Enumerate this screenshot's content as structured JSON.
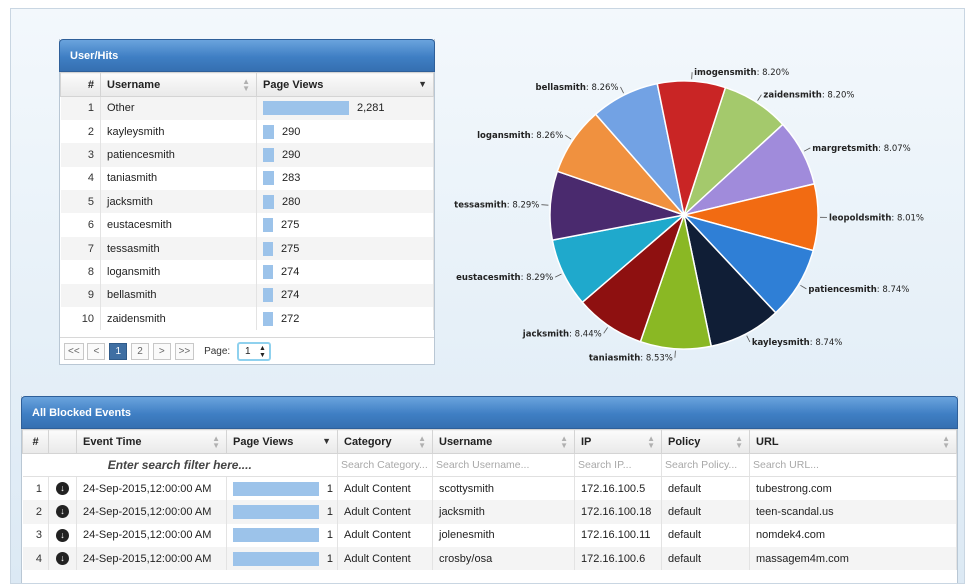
{
  "hits_panel": {
    "title": "User/Hits",
    "columns": [
      "#",
      "Username",
      "Page Views"
    ],
    "rows": [
      {
        "n": "1",
        "user": "Other",
        "views": "2,281",
        "value": 2281
      },
      {
        "n": "2",
        "user": "kayleysmith",
        "views": "290",
        "value": 290
      },
      {
        "n": "3",
        "user": "patiencesmith",
        "views": "290",
        "value": 290
      },
      {
        "n": "4",
        "user": "taniasmith",
        "views": "283",
        "value": 283
      },
      {
        "n": "5",
        "user": "jacksmith",
        "views": "280",
        "value": 280
      },
      {
        "n": "6",
        "user": "eustacesmith",
        "views": "275",
        "value": 275
      },
      {
        "n": "7",
        "user": "tessasmith",
        "views": "275",
        "value": 275
      },
      {
        "n": "8",
        "user": "logansmith",
        "views": "274",
        "value": 274
      },
      {
        "n": "9",
        "user": "bellasmith",
        "views": "274",
        "value": 274
      },
      {
        "n": "10",
        "user": "zaidensmith",
        "views": "272",
        "value": 272
      }
    ],
    "pager": {
      "first": "<<",
      "prev": "<",
      "pages": [
        "1",
        "2"
      ],
      "current": "1",
      "next": ">",
      "last": ">>",
      "page_label": "Page:",
      "page_value": "1"
    }
  },
  "chart_data": {
    "type": "pie",
    "slices": [
      {
        "name": "zaidensmith",
        "label": "8.20%",
        "value": 8.2,
        "color": "#a4c96c"
      },
      {
        "name": "margretsmith",
        "label": "8.07%",
        "value": 8.07,
        "color": "#a08bdb"
      },
      {
        "name": "leopoldsmith",
        "label": "8.01%",
        "value": 8.01,
        "color": "#f26b12"
      },
      {
        "name": "patiencesmith",
        "label": "8.74%",
        "value": 8.74,
        "color": "#2f7fd6"
      },
      {
        "name": "kayleysmith",
        "label": "8.74%",
        "value": 8.74,
        "color": "#101e36"
      },
      {
        "name": "taniasmith",
        "label": "8.53%",
        "value": 8.53,
        "color": "#8ab824"
      },
      {
        "name": "jacksmith",
        "label": "8.44%",
        "value": 8.44,
        "color": "#8e1010"
      },
      {
        "name": "eustacesmith",
        "label": "8.29%",
        "value": 8.29,
        "color": "#1fa9cc"
      },
      {
        "name": "tessasmith",
        "label": "8.29%",
        "value": 8.29,
        "color": "#4a2a6e"
      },
      {
        "name": "logansmith",
        "label": "8.26%",
        "value": 8.26,
        "color": "#f0913f"
      },
      {
        "name": "bellasmith",
        "label": "8.26%",
        "value": 8.26,
        "color": "#72a2e4"
      },
      {
        "name": "imogensmith",
        "label": "8.20%",
        "value": 8.2,
        "color": "#c92525"
      }
    ]
  },
  "events_panel": {
    "title": "All Blocked Events",
    "columns": [
      "#",
      "",
      "Event Time",
      "Page Views",
      "Category",
      "Username",
      "IP",
      "Policy",
      "URL"
    ],
    "filter_main": "Enter search filter here....",
    "filter_placeholders": [
      "Search Category...",
      "Search Username...",
      "Search IP...",
      "Search Policy...",
      "Search URL..."
    ],
    "rows": [
      {
        "n": "1",
        "time": "24-Sep-2015,12:00:00 AM",
        "views": "1",
        "category": "Adult Content",
        "user": "scottysmith",
        "ip": "172.16.100.5",
        "policy": "default",
        "url": "tubestrong.com"
      },
      {
        "n": "2",
        "time": "24-Sep-2015,12:00:00 AM",
        "views": "1",
        "category": "Adult Content",
        "user": "jacksmith",
        "ip": "172.16.100.18",
        "policy": "default",
        "url": "teen-scandal.us"
      },
      {
        "n": "3",
        "time": "24-Sep-2015,12:00:00 AM",
        "views": "1",
        "category": "Adult Content",
        "user": "jolenesmith",
        "ip": "172.16.100.11",
        "policy": "default",
        "url": "nomdek4.com"
      },
      {
        "n": "4",
        "time": "24-Sep-2015,12:00:00 AM",
        "views": "1",
        "category": "Adult Content",
        "user": "crosby/osa",
        "ip": "172.16.100.6",
        "policy": "default",
        "url": "massagem4m.com"
      }
    ]
  },
  "icons": {
    "download": "download-circle-icon",
    "sort": "sort-arrows-icon"
  }
}
